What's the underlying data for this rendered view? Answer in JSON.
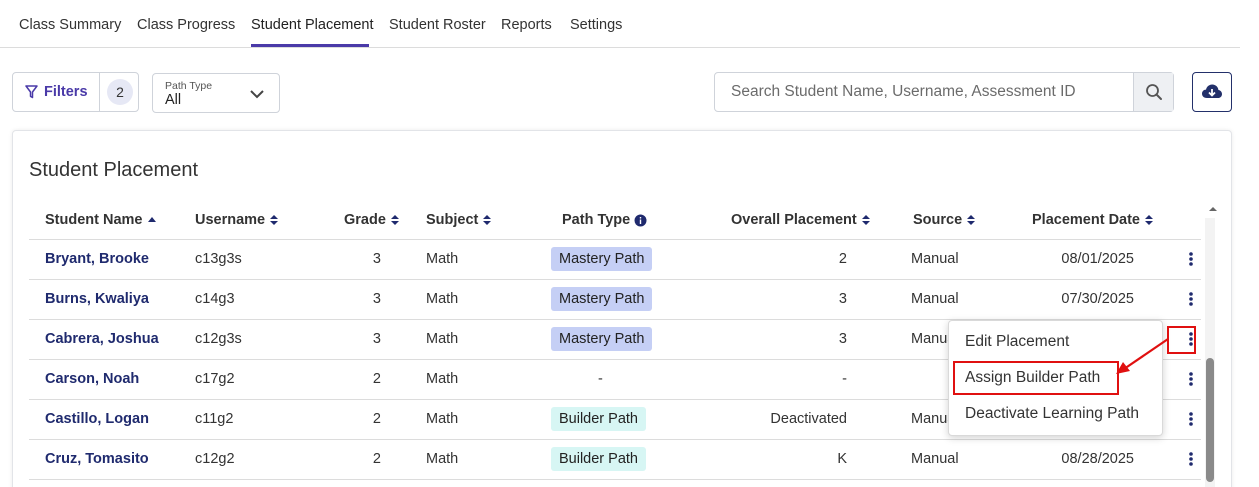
{
  "tabs": [
    {
      "label": "Class Summary"
    },
    {
      "label": "Class Progress"
    },
    {
      "label": "Student Placement"
    },
    {
      "label": "Student Roster"
    },
    {
      "label": "Reports"
    },
    {
      "label": "Settings"
    }
  ],
  "active_tab": "Student Placement",
  "toolbar": {
    "filters_label": "Filters",
    "filters_count": "2",
    "path_type_label": "Path Type",
    "path_type_value": "All",
    "search_placeholder": "Search Student Name, Username, Assessment ID"
  },
  "card": {
    "title": "Student Placement",
    "columns": [
      {
        "label": "Student Name",
        "sort": "ascending"
      },
      {
        "label": "Username",
        "sort": "none"
      },
      {
        "label": "Grade",
        "sort": "none"
      },
      {
        "label": "Subject",
        "sort": "none"
      },
      {
        "label": "Path Type",
        "sort": "info"
      },
      {
        "label": "Overall Placement",
        "sort": "none"
      },
      {
        "label": "Source",
        "sort": "none"
      },
      {
        "label": "Placement Date",
        "sort": "none"
      }
    ],
    "rows": [
      {
        "name": "Bryant, Brooke",
        "username": "c13g3s",
        "grade": "3",
        "subject": "Math",
        "path_type": "Mastery Path",
        "overall_placement": "2",
        "source": "Manual",
        "placement_date": "08/01/2025"
      },
      {
        "name": "Burns, Kwaliya",
        "username": "c14g3",
        "grade": "3",
        "subject": "Math",
        "path_type": "Mastery Path",
        "overall_placement": "3",
        "source": "Manual",
        "placement_date": "07/30/2025"
      },
      {
        "name": "Cabrera, Joshua",
        "username": "c12g3s",
        "grade": "3",
        "subject": "Math",
        "path_type": "Mastery Path",
        "overall_placement": "3",
        "source": "Manua",
        "placement_date": ""
      },
      {
        "name": "Carson, Noah",
        "username": "c17g2",
        "grade": "2",
        "subject": "Math",
        "path_type": "-",
        "overall_placement": "-",
        "source": "",
        "placement_date": ""
      },
      {
        "name": "Castillo, Logan",
        "username": "c11g2",
        "grade": "2",
        "subject": "Math",
        "path_type": "Builder Path",
        "overall_placement": "Deactivated",
        "source": "Manua",
        "placement_date": ""
      },
      {
        "name": "Cruz, Tomasito",
        "username": "c12g2",
        "grade": "2",
        "subject": "Math",
        "path_type": "Builder Path",
        "overall_placement": "K",
        "source": "Manual",
        "placement_date": "08/28/2025"
      }
    ]
  },
  "context_menu": {
    "items": [
      {
        "label": "Edit Placement"
      },
      {
        "label": "Assign Builder Path"
      },
      {
        "label": "Deactivate Learning Path"
      }
    ]
  },
  "colors": {
    "accent": "#4a3aa8",
    "link": "#1f2a6e",
    "mastery_pill": "#c5cff5",
    "builder_pill": "#d7f6f4",
    "highlight": "#e01010"
  }
}
